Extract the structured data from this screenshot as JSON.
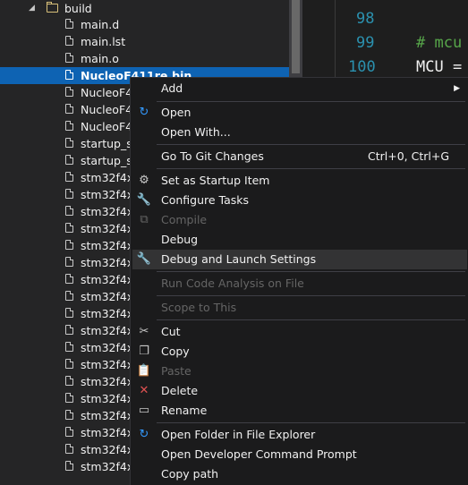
{
  "tree": {
    "folder": "build",
    "files": [
      "main.d",
      "main.lst",
      "main.o",
      "NucleoF411re.bin",
      "NucleoF4",
      "NucleoF4",
      "NucleoF4",
      "startup_st",
      "startup_st",
      "stm32f4x",
      "stm32f4x",
      "stm32f4x",
      "stm32f4x",
      "stm32f4x",
      "stm32f4x",
      "stm32f4x",
      "stm32f4x",
      "stm32f4x",
      "stm32f4x",
      "stm32f4x",
      "stm32f4x",
      "stm32f4x",
      "stm32f4x",
      "stm32f4x",
      "stm32f4x",
      "stm32f4x",
      "stm32f4x"
    ]
  },
  "editor": {
    "lines": [
      {
        "no": "98",
        "text": ""
      },
      {
        "no": "99",
        "text": "# mcu"
      },
      {
        "no": "100",
        "text": "MCU ="
      }
    ]
  },
  "menu": {
    "add": "Add",
    "open": "Open",
    "open_with": "Open With...",
    "git_changes": "Go To Git Changes",
    "git_shortcut": "Ctrl+0, Ctrl+G",
    "startup_item": "Set as Startup Item",
    "configure_tasks": "Configure Tasks",
    "compile": "Compile",
    "debug": "Debug",
    "debug_launch": "Debug and Launch Settings",
    "code_analysis": "Run Code Analysis on File",
    "scope": "Scope to This",
    "cut": "Cut",
    "copy": "Copy",
    "paste": "Paste",
    "delete": "Delete",
    "rename": "Rename",
    "open_folder": "Open Folder in File Explorer",
    "dev_prompt": "Open Developer Command Prompt",
    "copy_path": "Copy path"
  }
}
